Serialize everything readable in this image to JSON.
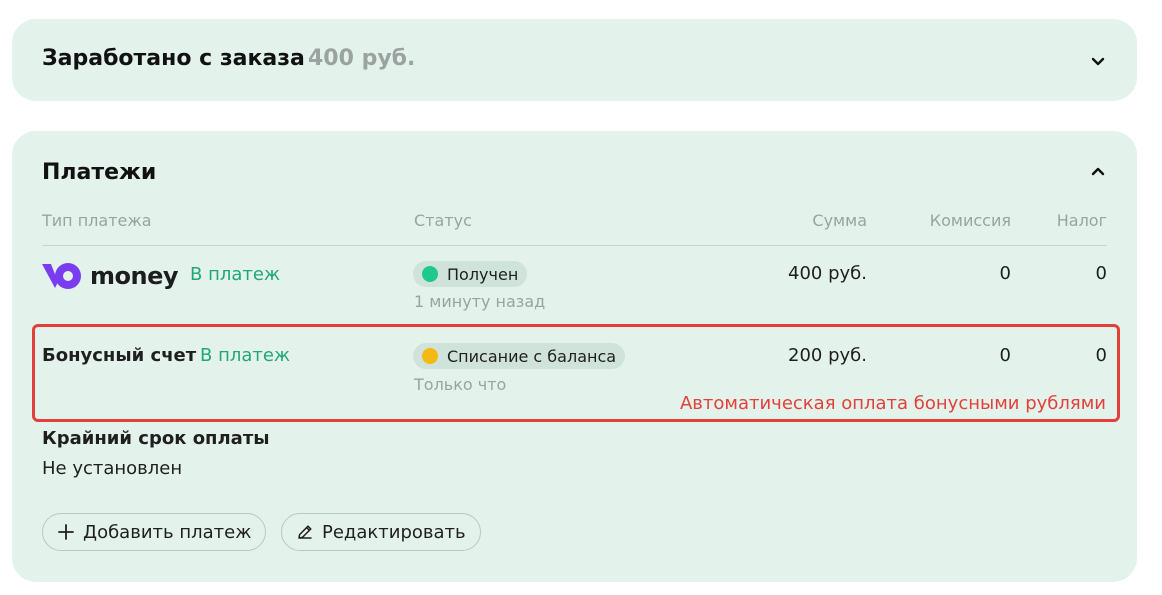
{
  "earned": {
    "title": "Заработано с заказа",
    "amount": "400 руб."
  },
  "payments": {
    "title": "Платежи",
    "columns": {
      "type": "Тип платежа",
      "status": "Статус",
      "sum": "Сумма",
      "commission": "Комиссия",
      "tax": "Налог"
    },
    "rows": [
      {
        "type_logo_text": "money",
        "type_link": "В платеж",
        "status": "Получен",
        "status_color": "#1ec98a",
        "time": "1 минуту назад",
        "sum": "400 руб.",
        "commission": "0",
        "tax": "0"
      },
      {
        "type": "Бонусный счет",
        "type_link": "В платеж",
        "status": "Списание с баланса",
        "status_color": "#f5b914",
        "time": "Только что",
        "sum": "200 руб.",
        "commission": "0",
        "tax": "0"
      }
    ],
    "annotation": "Автоматическая оплата бонусными рублями",
    "deadline_label": "Крайний срок оплаты",
    "deadline_value": "Не установлен",
    "buttons": {
      "add": "Добавить платеж",
      "edit": "Редактировать"
    }
  },
  "colors": {
    "card_bg": "#e3f3ec",
    "accent_green": "#21a772",
    "annotation_red": "#e2413a",
    "logo_purple": "#7a3cf0"
  },
  "icons": {
    "expand": "chevron-down-icon",
    "collapse": "chevron-up-icon",
    "add": "plus-icon",
    "edit": "pencil-icon"
  }
}
